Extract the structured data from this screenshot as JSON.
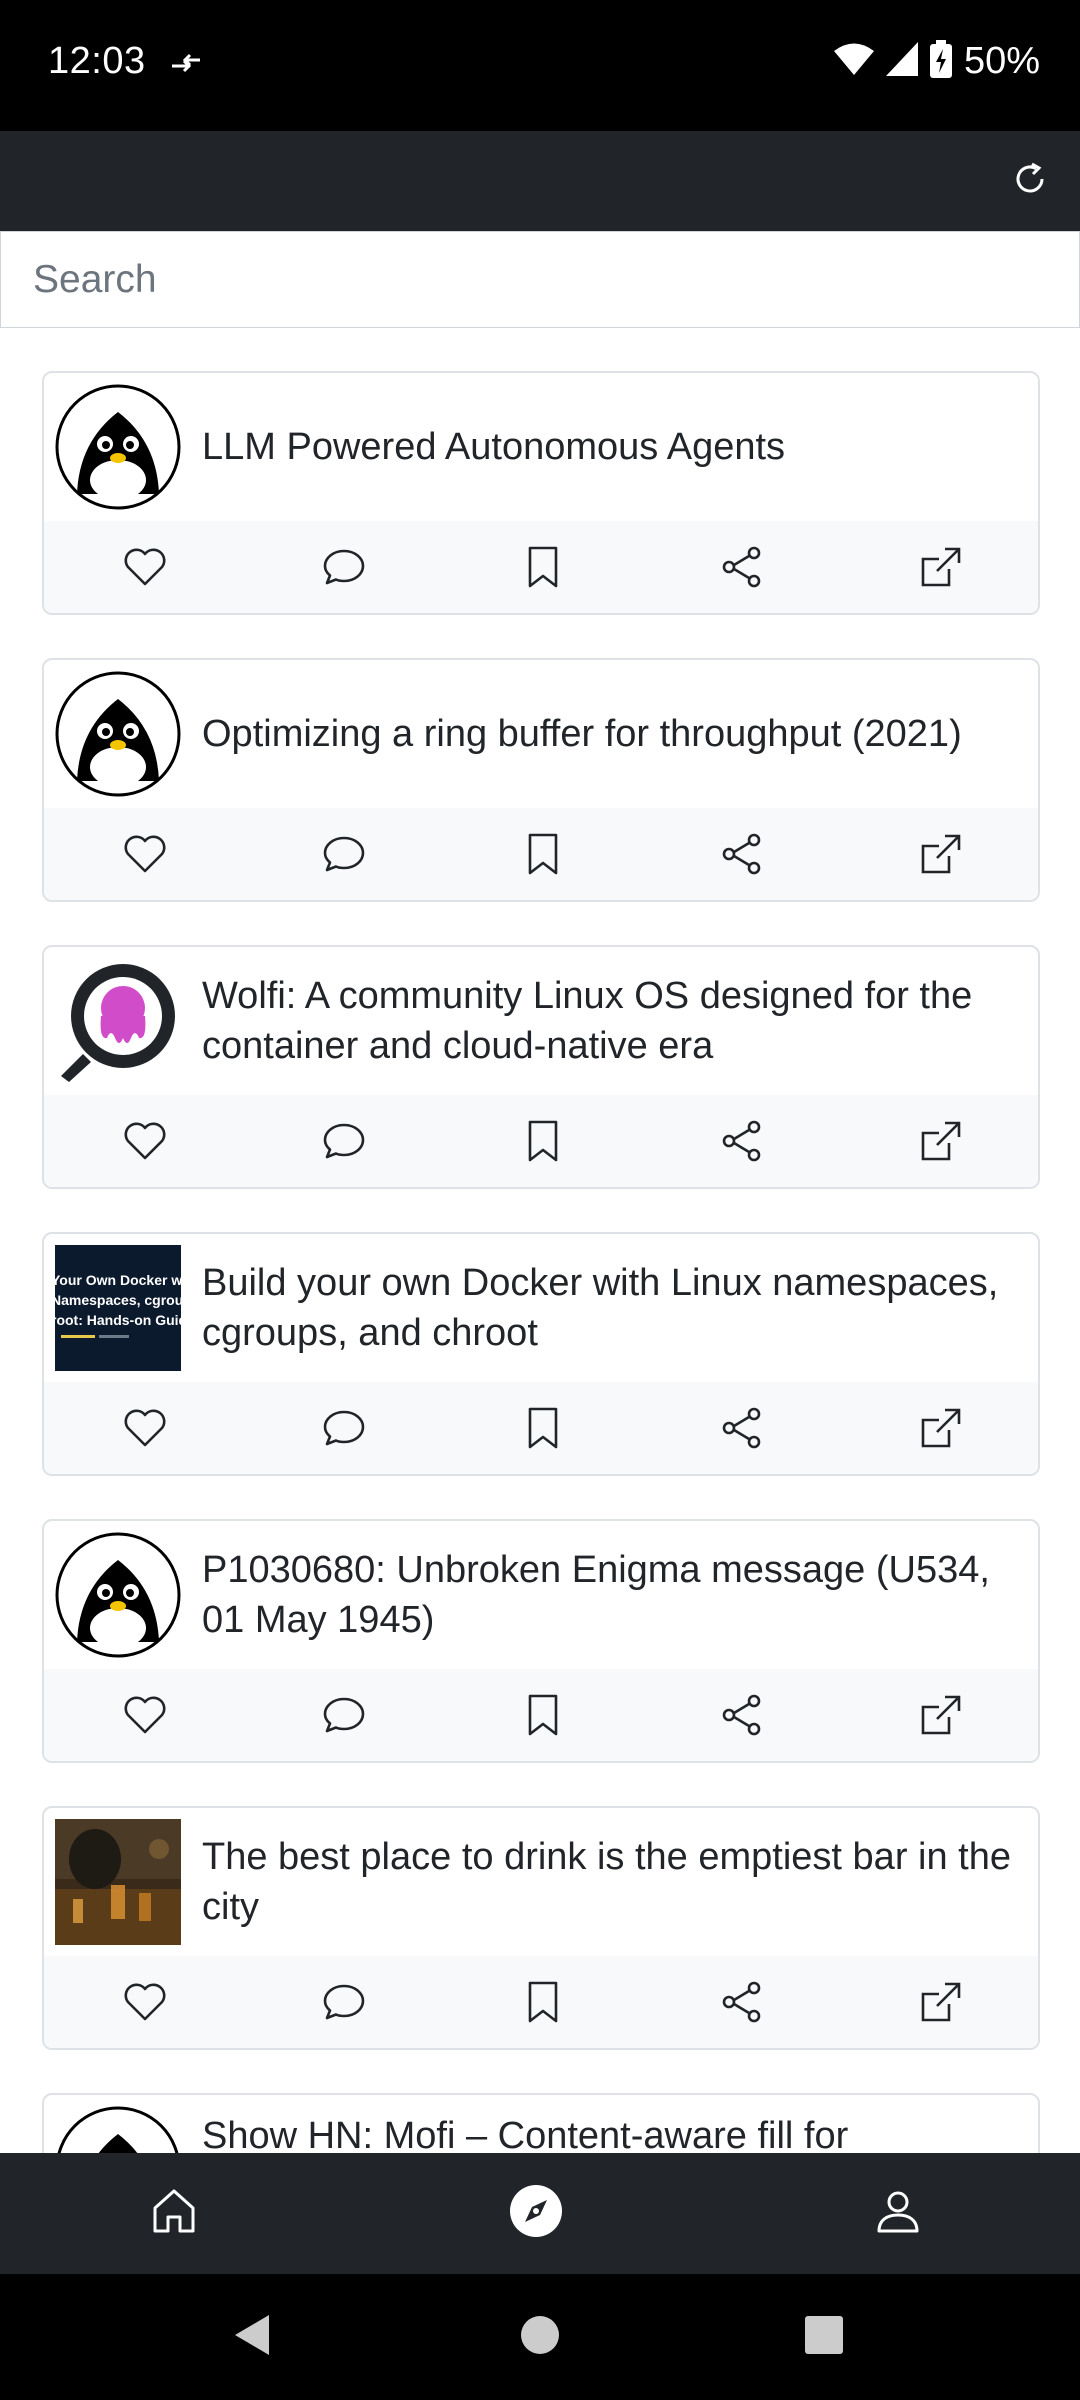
{
  "status_bar": {
    "time": "12:03",
    "battery_percent": "50%",
    "icons": [
      "sync-arrows-icon",
      "wifi-icon",
      "cellular-signal-icon",
      "battery-charging-icon"
    ]
  },
  "header": {
    "refresh_icon": "refresh-icon"
  },
  "search": {
    "placeholder": "Search",
    "value": ""
  },
  "feed": {
    "items": [
      {
        "title": "LLM Powered Autonomous Agents",
        "thumbnail": "penguin-avatar"
      },
      {
        "title": "Optimizing a ring buffer for throughput (2021)",
        "thumbnail": "penguin-avatar"
      },
      {
        "title": "Wolfi: A community Linux OS designed for the container and cloud-native era",
        "thumbnail": "octopus-magnifier-logo"
      },
      {
        "title": "Build your own Docker with Linux namespaces, cgroups, and chroot",
        "thumbnail": "docker-article-image",
        "thumb_lines": [
          "Your Own Docker wit",
          "Namespaces, cgroup",
          "root: Hands-on Guid"
        ]
      },
      {
        "title": "P1030680: Unbroken Enigma message (U534, 01 May 1945)",
        "thumbnail": "penguin-avatar"
      },
      {
        "title": "The best place to drink is the emptiest bar in the city",
        "thumbnail": "bar-photo"
      },
      {
        "title": "Show HN: Mofi – Content-aware fill for",
        "thumbnail": "penguin-avatar"
      }
    ],
    "actions": [
      {
        "name": "like",
        "icon": "heart-icon"
      },
      {
        "name": "comment",
        "icon": "comment-icon"
      },
      {
        "name": "bookmark",
        "icon": "bookmark-icon"
      },
      {
        "name": "share",
        "icon": "share-icon"
      },
      {
        "name": "open",
        "icon": "external-link-icon"
      }
    ]
  },
  "bottom_nav": {
    "items": [
      {
        "name": "home",
        "icon": "home-icon",
        "active": false
      },
      {
        "name": "explore",
        "icon": "compass-icon",
        "active": true
      },
      {
        "name": "profile",
        "icon": "person-icon",
        "active": false
      }
    ]
  },
  "system_nav": {
    "buttons": [
      "back-triangle-icon",
      "home-circle-icon",
      "recents-square-icon"
    ]
  },
  "colors": {
    "header_bg": "#212529",
    "action_bar_bg": "#f8f9fa",
    "card_border": "#dee2e6",
    "text": "#212529"
  }
}
